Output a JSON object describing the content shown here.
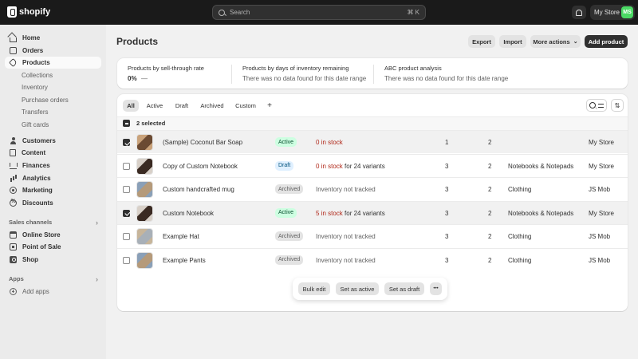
{
  "topbar": {
    "logo_text": "shopify",
    "search_placeholder": "Search",
    "search_shortcut": "⌘ K",
    "store_name": "My Store",
    "avatar_initials": "MS"
  },
  "sidebar": {
    "items": [
      {
        "label": "Home",
        "icon": "home-icon"
      },
      {
        "label": "Orders",
        "icon": "orders-icon"
      },
      {
        "label": "Products",
        "icon": "tag-icon",
        "active": true
      },
      {
        "label": "Customers",
        "icon": "person-icon"
      },
      {
        "label": "Content",
        "icon": "content-icon"
      },
      {
        "label": "Finances",
        "icon": "bank-icon"
      },
      {
        "label": "Analytics",
        "icon": "chart-icon"
      },
      {
        "label": "Marketing",
        "icon": "target-icon"
      },
      {
        "label": "Discounts",
        "icon": "discount-icon"
      }
    ],
    "product_subitems": [
      "Collections",
      "Inventory",
      "Purchase orders",
      "Transfers",
      "Gift cards"
    ],
    "sales_channels_heading": "Sales channels",
    "sales_channels": [
      {
        "label": "Online Store",
        "icon": "store-icon"
      },
      {
        "label": "Point of Sale",
        "icon": "pos-icon"
      },
      {
        "label": "Shop",
        "icon": "shop-icon"
      }
    ],
    "apps_heading": "Apps",
    "add_apps": "Add apps"
  },
  "header": {
    "title": "Products",
    "export": "Export",
    "import": "Import",
    "more_actions": "More actions",
    "add_product": "Add product"
  },
  "analytics": {
    "sell_through_title": "Products by sell-through rate",
    "sell_through_value": "0%",
    "sell_through_dash": "—",
    "days_inventory_title": "Products by days of inventory remaining",
    "days_inventory_msg": "There was no data found for this date range",
    "abc_title": "ABC product analysis",
    "abc_msg": "There was no data found for this date range"
  },
  "tabs": [
    "All",
    "Active",
    "Draft",
    "Archived",
    "Custom",
    "+"
  ],
  "selection": {
    "label": "2 selected"
  },
  "products": [
    {
      "name": "(Sample) Coconut Bar Soap",
      "status": "Active",
      "inv_red": "0 in stock",
      "inv_rest": "",
      "c1": "1",
      "c2": "2",
      "category": "",
      "vendor": "My Store",
      "checked": true,
      "thumb": [
        "#6b4a32",
        "#c9a27a"
      ]
    },
    {
      "name": "Copy of Custom Notebook",
      "status": "Draft",
      "inv_red": "0 in stock",
      "inv_rest": " for 24 variants",
      "c1": "3",
      "c2": "2",
      "category": "Notebooks & Notepads",
      "vendor": "My Store",
      "checked": false,
      "thumb": [
        "#3a2a22",
        "#d8d0c8"
      ]
    },
    {
      "name": "Custom handcrafted mug",
      "status": "Archived",
      "inv_red": "",
      "inv_rest": "Inventory not tracked",
      "c1": "3",
      "c2": "2",
      "category": "Clothing",
      "vendor": "JS Mob",
      "checked": false,
      "thumb": [
        "#b59a7a",
        "#8aa0b8"
      ]
    },
    {
      "name": "Custom Notebook",
      "status": "Active",
      "inv_red": "5 in stock",
      "inv_rest": " for 24 variants",
      "c1": "3",
      "c2": "2",
      "category": "Notebooks & Notepads",
      "vendor": "My Store",
      "checked": true,
      "thumb": [
        "#3a2a22",
        "#d8d0c8"
      ]
    },
    {
      "name": "Example Hat",
      "status": "Archived",
      "inv_red": "",
      "inv_rest": "Inventory not tracked",
      "c1": "3",
      "c2": "2",
      "category": "Clothing",
      "vendor": "JS Mob",
      "checked": false,
      "thumb": [
        "#a8b0b8",
        "#c7b59a"
      ]
    },
    {
      "name": "Example Pants",
      "status": "Archived",
      "inv_red": "",
      "inv_rest": "Inventory not tracked",
      "c1": "3",
      "c2": "2",
      "category": "Clothing",
      "vendor": "JS Mob",
      "checked": false,
      "thumb": [
        "#b59a7a",
        "#8aa0b8"
      ]
    }
  ],
  "bulk_actions": {
    "bulk_edit": "Bulk edit",
    "set_active": "Set as active",
    "set_draft": "Set as draft",
    "more": "•••"
  }
}
